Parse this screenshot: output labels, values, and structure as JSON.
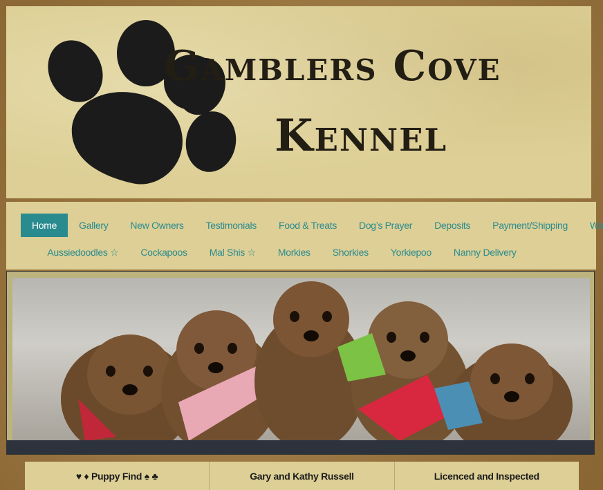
{
  "logo": {
    "line1": "Gamblers Cove",
    "line2": "Kennel"
  },
  "nav": {
    "row1": [
      {
        "label": "Home",
        "active": true
      },
      {
        "label": "Gallery"
      },
      {
        "label": "New Owners"
      },
      {
        "label": "Testimonials"
      },
      {
        "label": "Food & Treats"
      },
      {
        "label": "Dog’s Prayer"
      },
      {
        "label": "Deposits"
      },
      {
        "label": "Payment/Shipping"
      },
      {
        "label": "Warranty"
      }
    ],
    "row2": [
      {
        "label": "Aussiedoodles ☆"
      },
      {
        "label": "Cockapoos"
      },
      {
        "label": "Mal Shis ☆"
      },
      {
        "label": "Morkies"
      },
      {
        "label": "Shorkies"
      },
      {
        "label": "Yorkiepoo"
      },
      {
        "label": "Nanny Delivery"
      }
    ]
  },
  "banner": {
    "icon": "puppies-photo"
  },
  "footer": {
    "col1": "♥ ♦ Puppy Find ♠ ♣",
    "col2": "Gary and Kathy Russell",
    "col3": "Licenced and Inspected"
  },
  "colors": {
    "accent": "#2a8b8f",
    "panel": "#ddcf95",
    "bar": "#2d333d"
  }
}
